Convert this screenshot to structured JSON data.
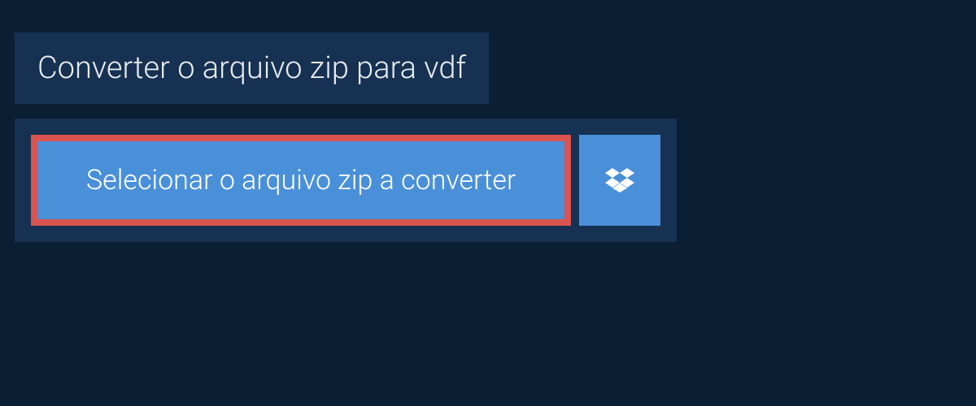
{
  "header": {
    "title": "Converter o arquivo zip para vdf"
  },
  "actions": {
    "select_file_label": "Selecionar o arquivo zip a converter"
  }
}
